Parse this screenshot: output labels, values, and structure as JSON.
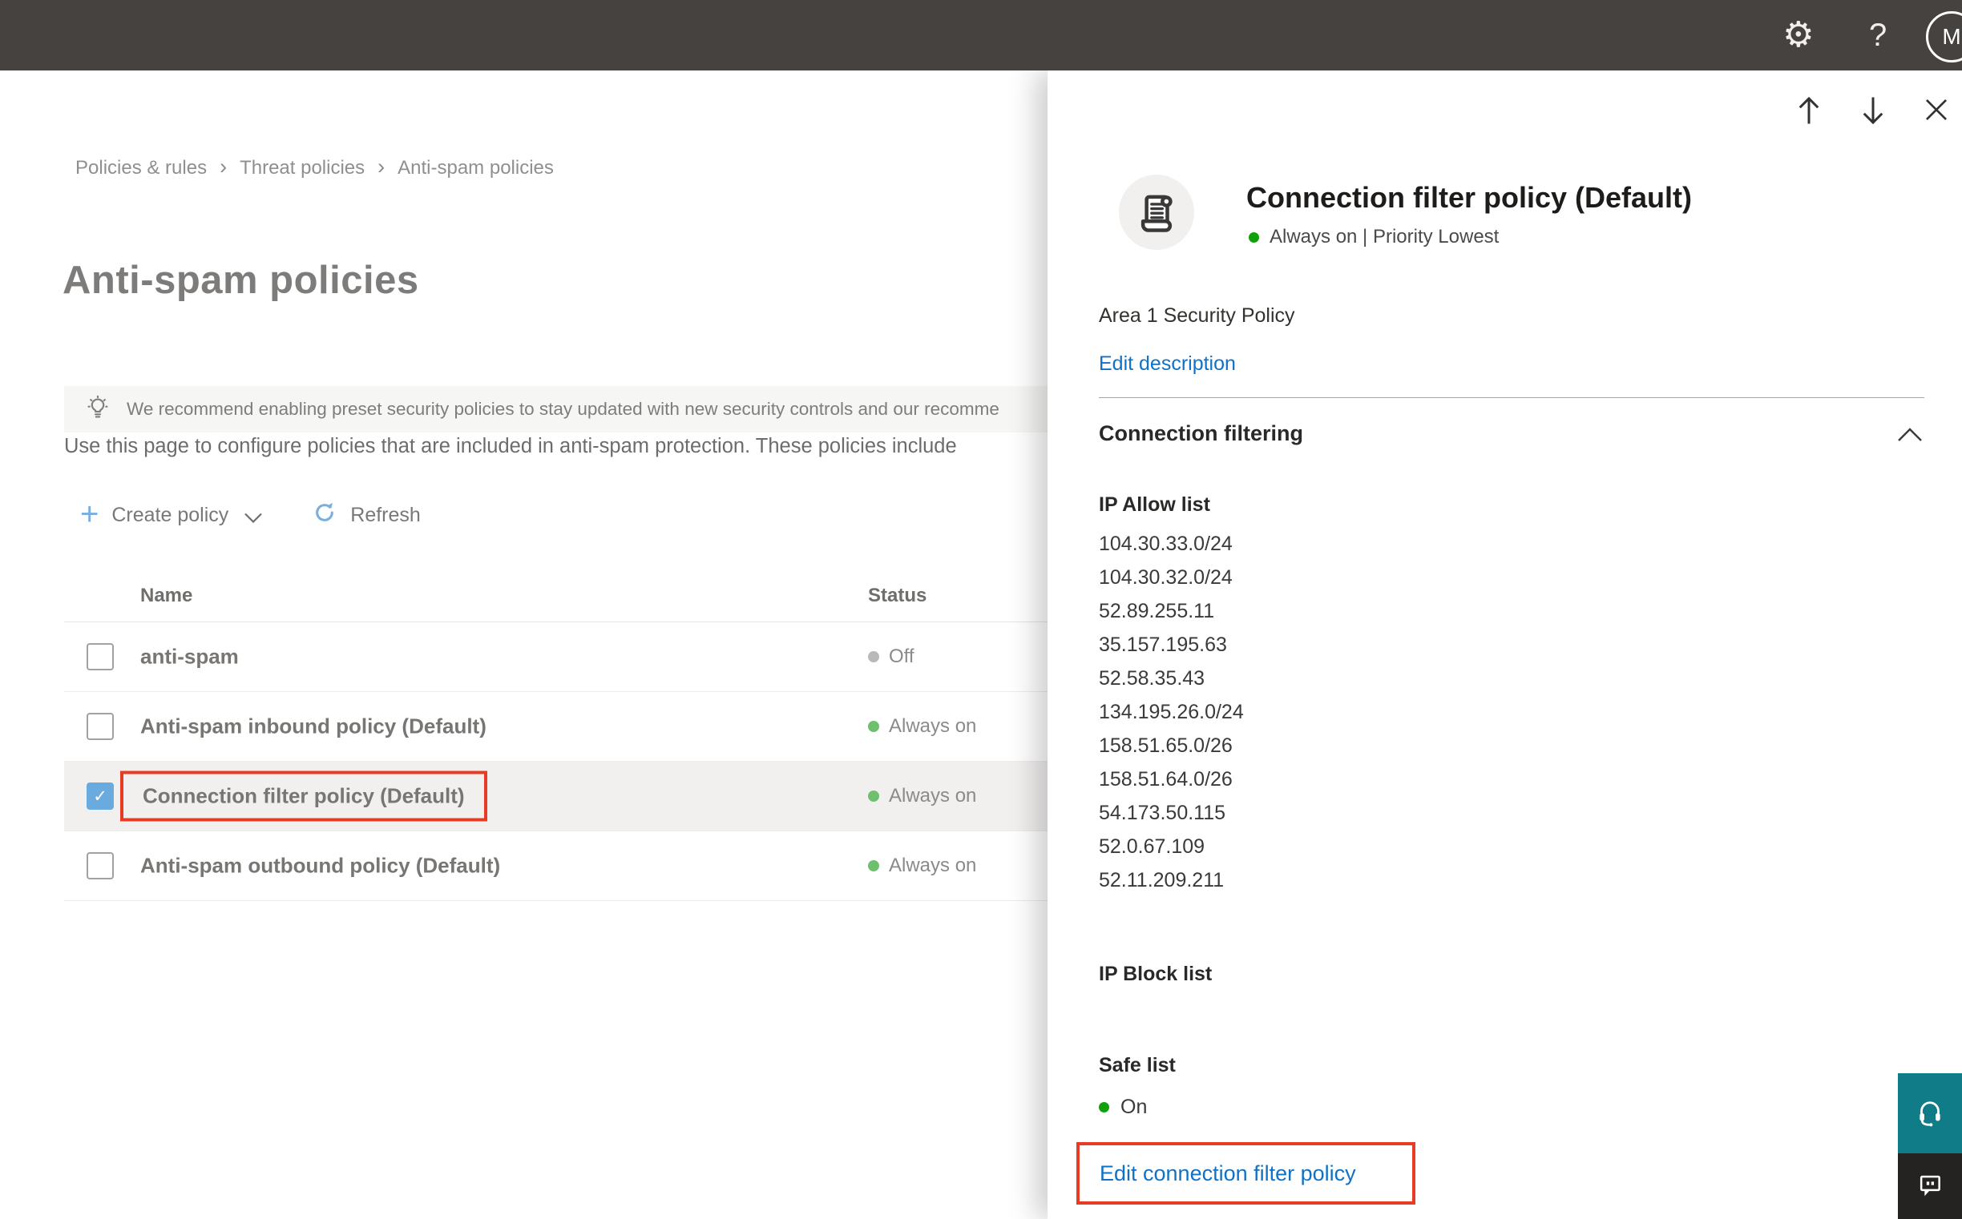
{
  "topbar": {
    "avatar_initial": "M",
    "help_glyph": "?"
  },
  "icons": {
    "gear": "⚙",
    "check": "✓",
    "plus": "+"
  },
  "breadcrumb": {
    "items": [
      "Policies & rules",
      "Threat policies",
      "Anti-spam policies"
    ],
    "separator": "›"
  },
  "page": {
    "title": "Anti-spam policies",
    "banner_text": "We recommend enabling preset security policies to stay updated with new security controls and our recomme",
    "description": "Use this page to configure policies that are included in anti-spam protection. These policies include"
  },
  "toolbar": {
    "create_policy_label": "Create policy",
    "refresh_label": "Refresh"
  },
  "table": {
    "columns": [
      "Name",
      "Status"
    ],
    "rows": [
      {
        "name": "anti-spam",
        "status": "Off",
        "status_type": "off",
        "checked": false,
        "highlighted": false
      },
      {
        "name": "Anti-spam inbound policy (Default)",
        "status": "Always on",
        "status_type": "on",
        "checked": false,
        "highlighted": false
      },
      {
        "name": "Connection filter policy (Default)",
        "status": "Always on",
        "status_type": "on",
        "checked": true,
        "highlighted": true
      },
      {
        "name": "Anti-spam outbound policy (Default)",
        "status": "Always on",
        "status_type": "on",
        "checked": false,
        "highlighted": false
      }
    ]
  },
  "flyout": {
    "title": "Connection filter policy (Default)",
    "status_text": "Always on | Priority Lowest",
    "policy_description": "Area 1 Security Policy",
    "edit_description_label": "Edit description",
    "section_title": "Connection filtering",
    "ip_allow_title": "IP Allow list",
    "ip_allow_list": [
      "104.30.33.0/24",
      "104.30.32.0/24",
      "52.89.255.11",
      "35.157.195.63",
      "52.58.35.43",
      "134.195.26.0/24",
      "158.51.65.0/26",
      "158.51.64.0/26",
      "54.173.50.115",
      "52.0.67.109",
      "52.11.209.211"
    ],
    "ip_block_title": "IP Block list",
    "safe_list_title": "Safe list",
    "safe_list_status": "On",
    "edit_link_label": "Edit connection filter policy"
  },
  "colors": {
    "topbar_bg": "#454240",
    "link_blue": "#1072c6",
    "highlight_red": "#e83b23",
    "green_on": "#11a00c",
    "table_green": "#6ec06e",
    "off_gray": "#bbb9b7",
    "checkbox_blue": "#6aabdf",
    "teal_button": "#107c88",
    "dark_button": "#242322"
  }
}
